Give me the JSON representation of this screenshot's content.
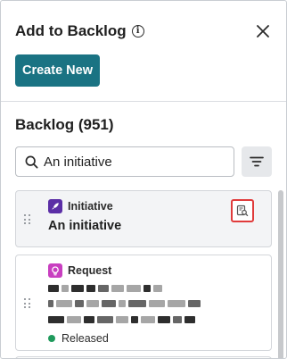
{
  "header": {
    "title": "Add to Backlog",
    "info_icon": "info-icon",
    "close_icon": "close-icon",
    "create_label": "Create New"
  },
  "backlog": {
    "title": "Backlog (951)",
    "search_value": "An initiative",
    "search_icon": "search-icon",
    "filter_icon": "filter-icon"
  },
  "items": [
    {
      "type": "Initiative",
      "type_icon": "rocket-icon",
      "type_color": "#5b2ea6",
      "name": "An initiative",
      "preview_icon": "preview-icon",
      "highlight_color": "#e03b3b"
    },
    {
      "type": "Request",
      "type_icon": "lightbulb-icon",
      "type_color": "#c83fc0",
      "status": "Released",
      "status_color": "#1f9a5c"
    }
  ],
  "colors": {
    "accent": "#1a7383"
  }
}
